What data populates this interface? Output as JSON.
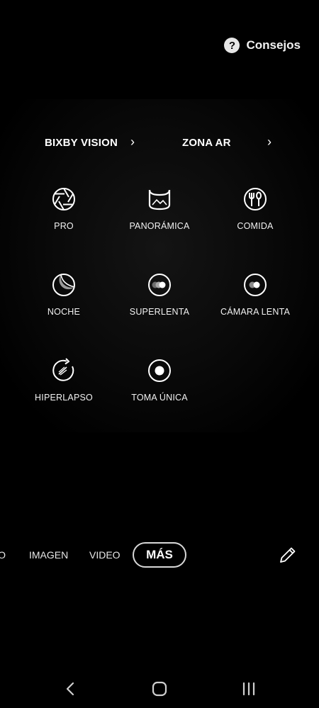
{
  "header": {
    "tips_icon": "question-circle-icon",
    "tips_label": "Consejos"
  },
  "links": [
    {
      "label": "BIXBY VISION",
      "icon": "chevron-right-icon"
    },
    {
      "label": "ZONA AR",
      "icon": "chevron-right-icon"
    }
  ],
  "modes": [
    {
      "label": "PRO",
      "icon": "aperture-icon"
    },
    {
      "label": "PANORÁMICA",
      "icon": "panorama-icon"
    },
    {
      "label": "COMIDA",
      "icon": "food-icon"
    },
    {
      "label": "NOCHE",
      "icon": "moon-icon"
    },
    {
      "label": "SUPERLENTA",
      "icon": "super-slow-motion-icon"
    },
    {
      "label": "CÁMARA LENTA",
      "icon": "slow-motion-icon"
    },
    {
      "label": "HIPERLAPSO",
      "icon": "hyperlapse-icon"
    },
    {
      "label": "TOMA ÚNICA",
      "icon": "single-take-icon"
    }
  ],
  "mode_bar": {
    "items": [
      "CO",
      "IMAGEN",
      "VIDEO",
      "MÁS"
    ],
    "selected": "MÁS",
    "edit_icon": "pencil-icon"
  },
  "nav_bar": {
    "icons": [
      "back-chevron-icon",
      "home-icon",
      "recent-apps-icon"
    ]
  },
  "colors": {
    "background": "#000000",
    "text": "#ffffff",
    "selected_border": "#d8d8d8"
  }
}
